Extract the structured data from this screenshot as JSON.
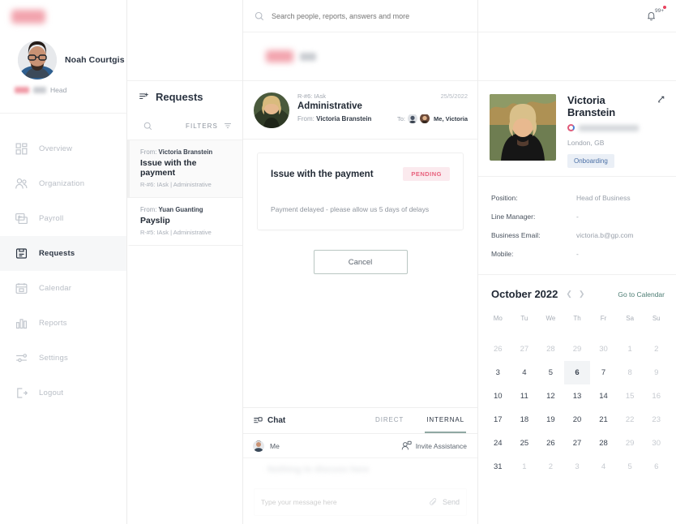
{
  "topbar": {
    "search_placeholder": "Search people, reports, answers and more",
    "search_value": "",
    "notification_count": "99+",
    "bell_icon": "bell-icon",
    "search_icon": "search-icon"
  },
  "sidebar": {
    "logo": "company-logo",
    "user": {
      "name": "Noah Courtgis",
      "role_suffix": "Head",
      "avatar": "user-avatar"
    },
    "items": [
      {
        "label": "Overview",
        "icon": "grid-icon",
        "active": false
      },
      {
        "label": "Organization",
        "icon": "people-icon",
        "active": false
      },
      {
        "label": "Payroll",
        "icon": "payroll-icon",
        "active": false
      },
      {
        "label": "Requests",
        "icon": "clipboard-icon",
        "active": true
      },
      {
        "label": "Calendar",
        "icon": "calendar-icon",
        "active": false
      },
      {
        "label": "Reports",
        "icon": "bar-chart-icon",
        "active": false
      },
      {
        "label": "Settings",
        "icon": "sliders-icon",
        "active": false
      },
      {
        "label": "Logout",
        "icon": "logout-icon",
        "active": false
      }
    ]
  },
  "requests_panel": {
    "title": "Requests",
    "title_icon": "list-add-icon",
    "search_icon": "search-icon",
    "filters_label": "FILTERS",
    "filter_icon": "filter-icon",
    "items": [
      {
        "from_label": "From:",
        "from_name": "Victoria Branstein",
        "subject": "Issue with the payment",
        "meta": "R-#6:  IAsk | Administrative",
        "selected": true
      },
      {
        "from_label": "From:",
        "from_name": "Yuan Guanting",
        "subject": "Payslip",
        "meta": "R-#5:  IAsk | Administrative",
        "selected": false
      }
    ]
  },
  "message": {
    "request_id": "R-#6:  IAsk",
    "title": "Administrative",
    "from_label": "From:",
    "from_name": "Victoria Branstein",
    "date": "25/5/2022",
    "to_label": "To:",
    "to_names": "Me, Victoria",
    "card": {
      "title": "Issue with the payment",
      "status": "PENDING",
      "body": "Payment delayed - please allow us 5 days of delays"
    },
    "cancel_label": "Cancel"
  },
  "chat": {
    "label": "Chat",
    "icon": "chat-icon",
    "tabs": [
      {
        "label": "DIRECT",
        "active": false
      },
      {
        "label": "INTERNAL",
        "active": true
      }
    ],
    "me_label": "Me",
    "invite_label": "Invite Assistance",
    "invite_icon": "add-person-icon",
    "ghost_text": "Nothing to discuss here",
    "input_placeholder": "Type your message here",
    "input_value": "",
    "send_label": "Send",
    "attach_icon": "attachment-icon"
  },
  "profile": {
    "name": "Victoria Branstein",
    "edit_icon": "edit-icon",
    "photo": "profile-photo",
    "location": "London, GB",
    "status": "Onboarding",
    "fields": [
      {
        "key": "Position:",
        "value": "Head of Business"
      },
      {
        "key": "Line Manager:",
        "value": "-"
      },
      {
        "key": "Business Email:",
        "value": "victoria.b@gp.com"
      },
      {
        "key": "Mobile:",
        "value": "-"
      }
    ]
  },
  "calendar": {
    "month": "October 2022",
    "prev_icon": "chevron-left-icon",
    "next_icon": "chevron-right-icon",
    "go_label": "Go to Calendar",
    "dow": [
      "Mo",
      "Tu",
      "We",
      "Th",
      "Fr",
      "Sa",
      "Su"
    ],
    "weeks": [
      [
        {
          "d": "26",
          "m": true
        },
        {
          "d": "27",
          "m": true
        },
        {
          "d": "28",
          "m": true
        },
        {
          "d": "29",
          "m": true
        },
        {
          "d": "30",
          "m": true
        },
        {
          "d": "1",
          "m": true
        },
        {
          "d": "2",
          "m": true
        }
      ],
      [
        {
          "d": "3",
          "m": false
        },
        {
          "d": "4",
          "m": false
        },
        {
          "d": "5",
          "m": false
        },
        {
          "d": "6",
          "m": false,
          "today": true
        },
        {
          "d": "7",
          "m": false
        },
        {
          "d": "8",
          "m": true
        },
        {
          "d": "9",
          "m": true
        }
      ],
      [
        {
          "d": "10",
          "m": false
        },
        {
          "d": "11",
          "m": false
        },
        {
          "d": "12",
          "m": false
        },
        {
          "d": "13",
          "m": false
        },
        {
          "d": "14",
          "m": false
        },
        {
          "d": "15",
          "m": true
        },
        {
          "d": "16",
          "m": true
        }
      ],
      [
        {
          "d": "17",
          "m": false
        },
        {
          "d": "18",
          "m": false
        },
        {
          "d": "19",
          "m": false
        },
        {
          "d": "20",
          "m": false
        },
        {
          "d": "21",
          "m": false
        },
        {
          "d": "22",
          "m": true
        },
        {
          "d": "23",
          "m": true
        }
      ],
      [
        {
          "d": "24",
          "m": false
        },
        {
          "d": "25",
          "m": false
        },
        {
          "d": "26",
          "m": false
        },
        {
          "d": "27",
          "m": false
        },
        {
          "d": "28",
          "m": false
        },
        {
          "d": "29",
          "m": true
        },
        {
          "d": "30",
          "m": true
        }
      ],
      [
        {
          "d": "31",
          "m": false
        },
        {
          "d": "1",
          "m": true
        },
        {
          "d": "2",
          "m": true
        },
        {
          "d": "3",
          "m": true
        },
        {
          "d": "4",
          "m": true
        },
        {
          "d": "5",
          "m": true
        },
        {
          "d": "6",
          "m": true
        }
      ]
    ]
  },
  "colors": {
    "accent_pink": "#e8627d",
    "badge_blue": "#4a6fa5",
    "link_green": "#4d7d74",
    "text_dark": "#222a35",
    "text_muted": "#9aa1ab"
  }
}
